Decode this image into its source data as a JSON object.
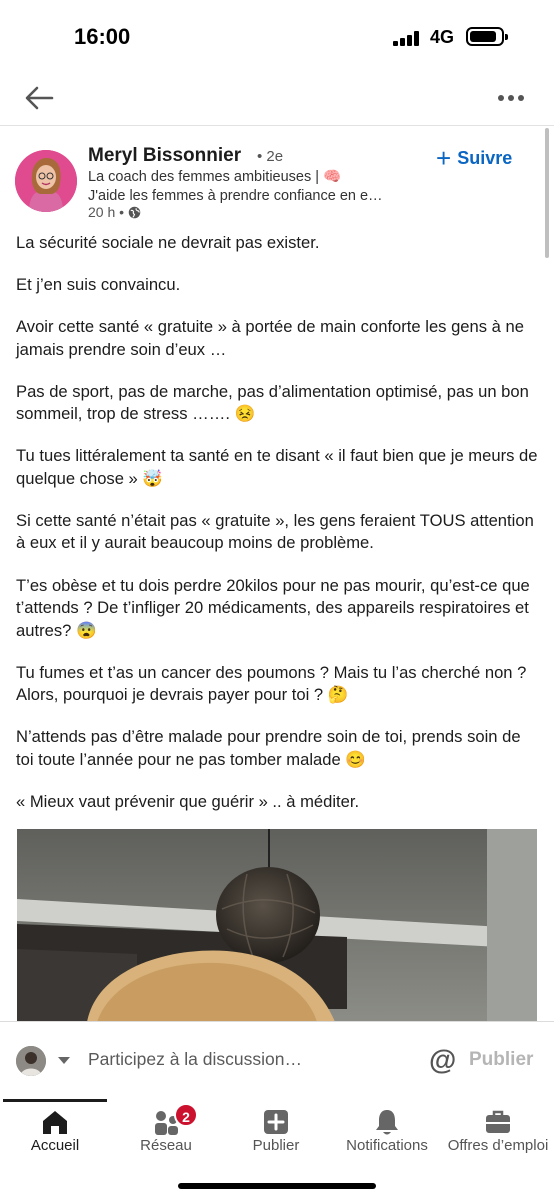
{
  "status": {
    "time": "16:00",
    "network": "4G"
  },
  "author": {
    "name": "Meryl Bissonnier",
    "degree": "• 2e",
    "headline_1": "La coach des femmes ambitieuses | 🧠",
    "headline_2": "J'aide les femmes à prendre confiance en e…",
    "time": "20 h •",
    "follow_label": "Suivre"
  },
  "post": {
    "paragraphs": [
      "La sécurité sociale ne devrait pas exister.",
      "Et j’en suis convaincu.",
      "Avoir cette santé « gratuite » à portée de main conforte les gens à ne jamais prendre soin d’eux …",
      "Pas de sport, pas de marche, pas d’alimentation optimisé, pas un bon sommeil, trop de stress ……. 😣",
      "Tu tues littéralement ta santé en te disant « il faut bien que je meurs de quelque chose » 🤯",
      "Si cette santé n’était pas « gratuite », les gens feraient TOUS attention à eux et il y aurait beaucoup moins de problème.",
      "T’es obèse et tu dois perdre 20kilos pour ne pas mourir, qu’est-ce que t’attends ? De t’infliger 20 médicaments, des appareils respiratoires et autres? 😨",
      "Tu fumes et t’as un cancer des poumons ? Mais tu l’as cherché non ? Alors, pourquoi je devrais payer pour toi ? 🤔",
      "N’attends pas d’être malade pour prendre soin de toi, prends soin de toi toute l’année pour ne pas tomber malade 😊",
      "« Mieux vaut prévenir que guérir » ..  à méditer."
    ]
  },
  "comment": {
    "placeholder": "Participez à la discussion…",
    "publish_label": "Publier",
    "mention_symbol": "@"
  },
  "tabs": [
    {
      "label": "Accueil",
      "icon": "home-icon",
      "active": true
    },
    {
      "label": "Réseau",
      "icon": "network-icon",
      "badge": "2"
    },
    {
      "label": "Publier",
      "icon": "post-icon"
    },
    {
      "label": "Notifications",
      "icon": "bell-icon"
    },
    {
      "label": "Offres d’emploi",
      "icon": "briefcase-icon"
    }
  ],
  "colors": {
    "accent": "#0a66c2",
    "badge": "#cb112d",
    "text": "#1c1c1c"
  }
}
